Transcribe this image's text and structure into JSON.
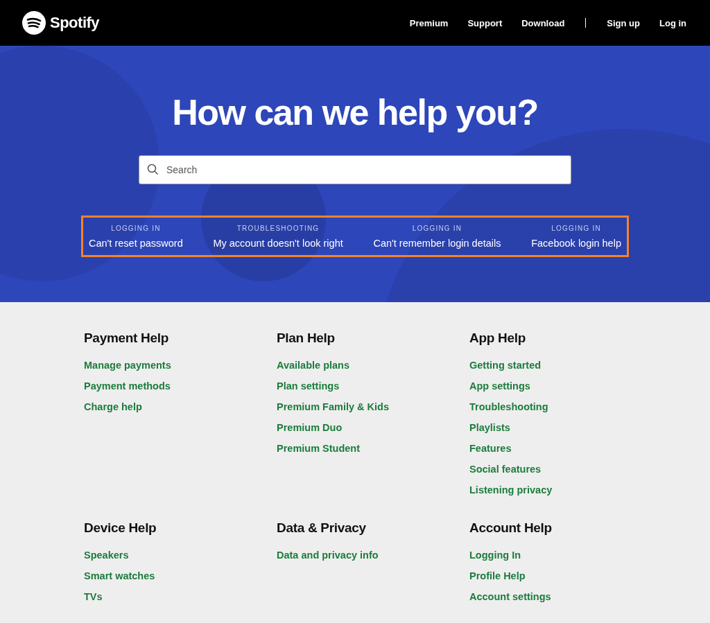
{
  "header": {
    "brand": "Spotify",
    "nav": [
      "Premium",
      "Support",
      "Download"
    ],
    "account": [
      "Sign up",
      "Log in"
    ]
  },
  "hero": {
    "title": "How can we help you?",
    "search": {
      "placeholder": "Search"
    },
    "topics": [
      {
        "category": "LOGGING IN",
        "title": "Can't reset password"
      },
      {
        "category": "TROUBLESHOOTING",
        "title": "My account doesn't look right"
      },
      {
        "category": "LOGGING IN",
        "title": "Can't remember login details"
      },
      {
        "category": "LOGGING IN",
        "title": "Facebook login help"
      }
    ]
  },
  "sections": [
    {
      "title": "Payment Help",
      "links": [
        "Manage payments",
        "Payment methods",
        "Charge help"
      ]
    },
    {
      "title": "Plan Help",
      "links": [
        "Available plans",
        "Plan settings",
        "Premium Family & Kids",
        "Premium Duo",
        "Premium Student"
      ]
    },
    {
      "title": "App Help",
      "links": [
        "Getting started",
        "App settings",
        "Troubleshooting",
        "Playlists",
        "Features",
        "Social features",
        "Listening privacy"
      ]
    },
    {
      "title": "Device Help",
      "links": [
        "Speakers",
        "Smart watches",
        "TVs"
      ]
    },
    {
      "title": "Data & Privacy",
      "links": [
        "Data and privacy info"
      ]
    },
    {
      "title": "Account Help",
      "links": [
        "Logging In",
        "Profile Help",
        "Account settings"
      ]
    }
  ]
}
